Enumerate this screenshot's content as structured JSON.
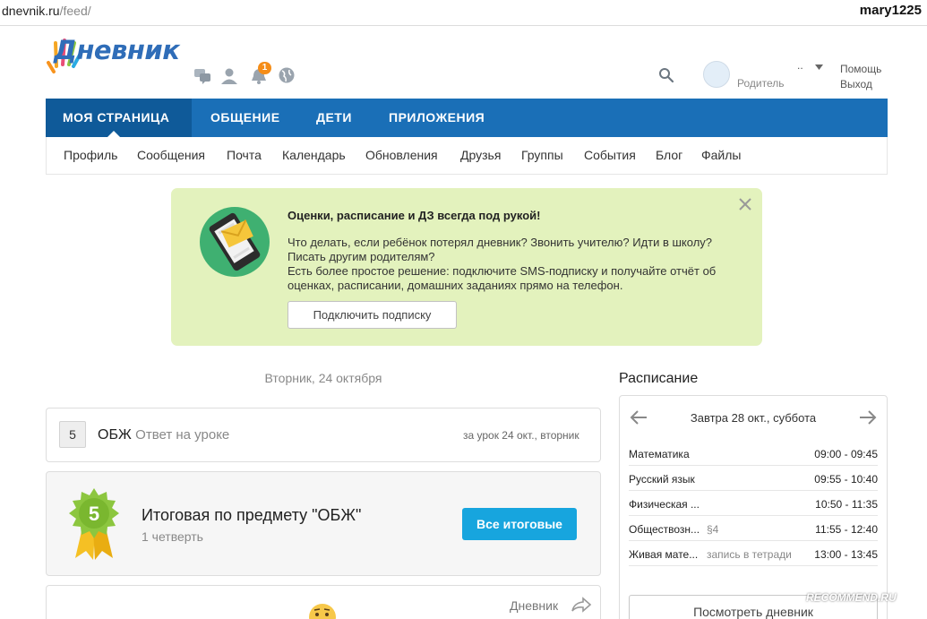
{
  "browser": {
    "domain": "dnevnik.ru",
    "path": "/feed/",
    "user": "mary1225"
  },
  "header": {
    "logo_text": "Дневник",
    "notification_count": "1",
    "user_role": "Родитель",
    "user_name": "..",
    "help_label": "Помощь",
    "logout_label": "Выход"
  },
  "mainnav": [
    "МОЯ СТРАНИЦА",
    "ОБЩЕНИЕ",
    "ДЕТИ",
    "ПРИЛОЖЕНИЯ"
  ],
  "subnav": [
    "Профиль",
    "Сообщения",
    "Почта",
    "Календарь",
    "Обновления",
    "Друзья",
    "Группы",
    "События",
    "Блог",
    "Файлы"
  ],
  "promo": {
    "title": "Оценки, расписание и ДЗ всегда под рукой!",
    "line1": "Что делать, если ребёнок потерял дневник? Звонить учителю? Идти в школу? Писать другим родителям?",
    "line2": "Есть более простое решение: подключите SMS-подписку и получайте отчёт об оценках, расписании, домашних заданиях прямо на телефон.",
    "button": "Подключить подписку"
  },
  "feed": {
    "date": "Вторник, 24 октября",
    "lesson": {
      "grade": "5",
      "subject": "ОБЖ",
      "hint": "Ответ на уроке",
      "meta": "за урок 24 окт., вторник"
    },
    "final": {
      "grade": "5",
      "title": "Итоговая по предмету \"ОБЖ\"",
      "period": "1 четверть",
      "button": "Все итоговые"
    },
    "diary_link": "Дневник"
  },
  "schedule": {
    "title": "Расписание",
    "date": "Завтра 28 окт., суббота",
    "rows": [
      {
        "name": "Математика",
        "note": "",
        "time": "09:00 - 09:45"
      },
      {
        "name": "Русский язык",
        "note": "",
        "time": "09:55 - 10:40"
      },
      {
        "name": "Физическая ...",
        "note": "",
        "time": "10:50 - 11:35"
      },
      {
        "name": "Обществозн...",
        "note": "§4",
        "time": "11:55 - 12:40"
      },
      {
        "name": "Живая мате...",
        "note": "запись в тетради",
        "time": "13:00 - 13:45"
      }
    ],
    "button": "Посмотреть дневник"
  },
  "watermark": "RECOMMEND.RU",
  "colors": {
    "nav_blue": "#1a6fb7",
    "nav_active": "#0f5a99",
    "promo_bg": "#e3f2bd",
    "accent_button": "#17a5de",
    "badge": "#f58d18",
    "grade_badge": "#8cc63f"
  }
}
